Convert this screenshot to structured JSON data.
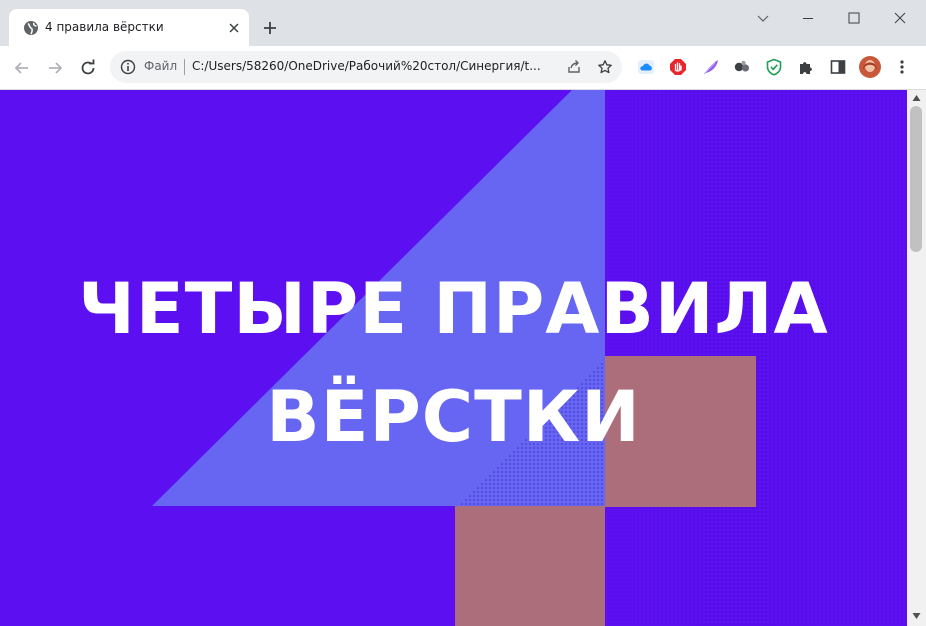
{
  "browser": {
    "tab": {
      "title": "4 правила вёрстки"
    },
    "address_bar": {
      "scheme_label": "Файл",
      "url": "C:/Users/58260/OneDrive/Рабочий%20стол/Синергия/t..."
    }
  },
  "page": {
    "hero": {
      "title_line1": "ЧЕТЫРЕ ПРАВИЛА",
      "title_line2": "ВЁРСТКИ"
    },
    "colors": {
      "background": "#5c0ff0",
      "triangle": "#6666f2",
      "squares": "#ad6e7b",
      "text": "#ffffff"
    }
  },
  "icons": {
    "back": "arrow-left-icon",
    "forward": "arrow-right-icon",
    "reload": "reload-icon",
    "info": "info-icon",
    "share": "share-icon",
    "bookmark": "star-icon",
    "extensions": [
      "cloud-icon",
      "adblock-icon",
      "feather-icon",
      "circles-icon",
      "shield-check-icon",
      "puzzle-icon",
      "side-panel-icon",
      "avatar",
      "kebab-menu-icon"
    ]
  }
}
